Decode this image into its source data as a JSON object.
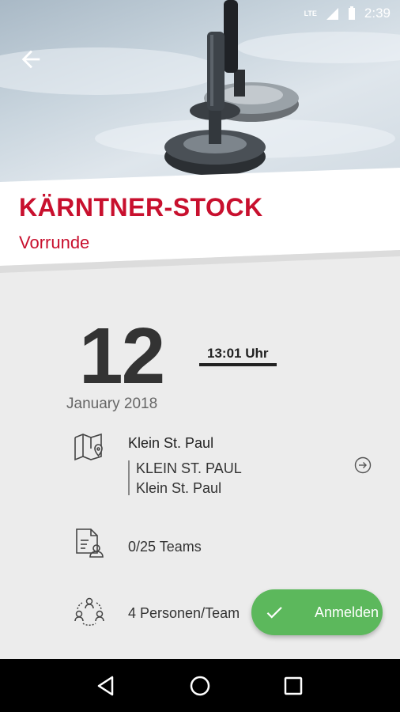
{
  "status_bar": {
    "network": "LTE",
    "time": "2:39"
  },
  "header": {
    "title": "KÄRNTNER-STOCK",
    "subtitle": "Vorrunde"
  },
  "event_date": {
    "day": "12",
    "month_year": "January 2018",
    "time": "13:01 Uhr"
  },
  "location": {
    "name": "Klein St. Paul",
    "address_line1": "KLEIN ST. PAUL",
    "address_line2": "Klein St. Paul"
  },
  "teams": {
    "label": "0/25 Teams"
  },
  "team_size": {
    "label": "4 Personen/Team"
  },
  "fab": {
    "label": "Anmelden"
  },
  "colors": {
    "accent": "#c8102e",
    "fab": "#5cb85c",
    "background": "#ececec"
  }
}
